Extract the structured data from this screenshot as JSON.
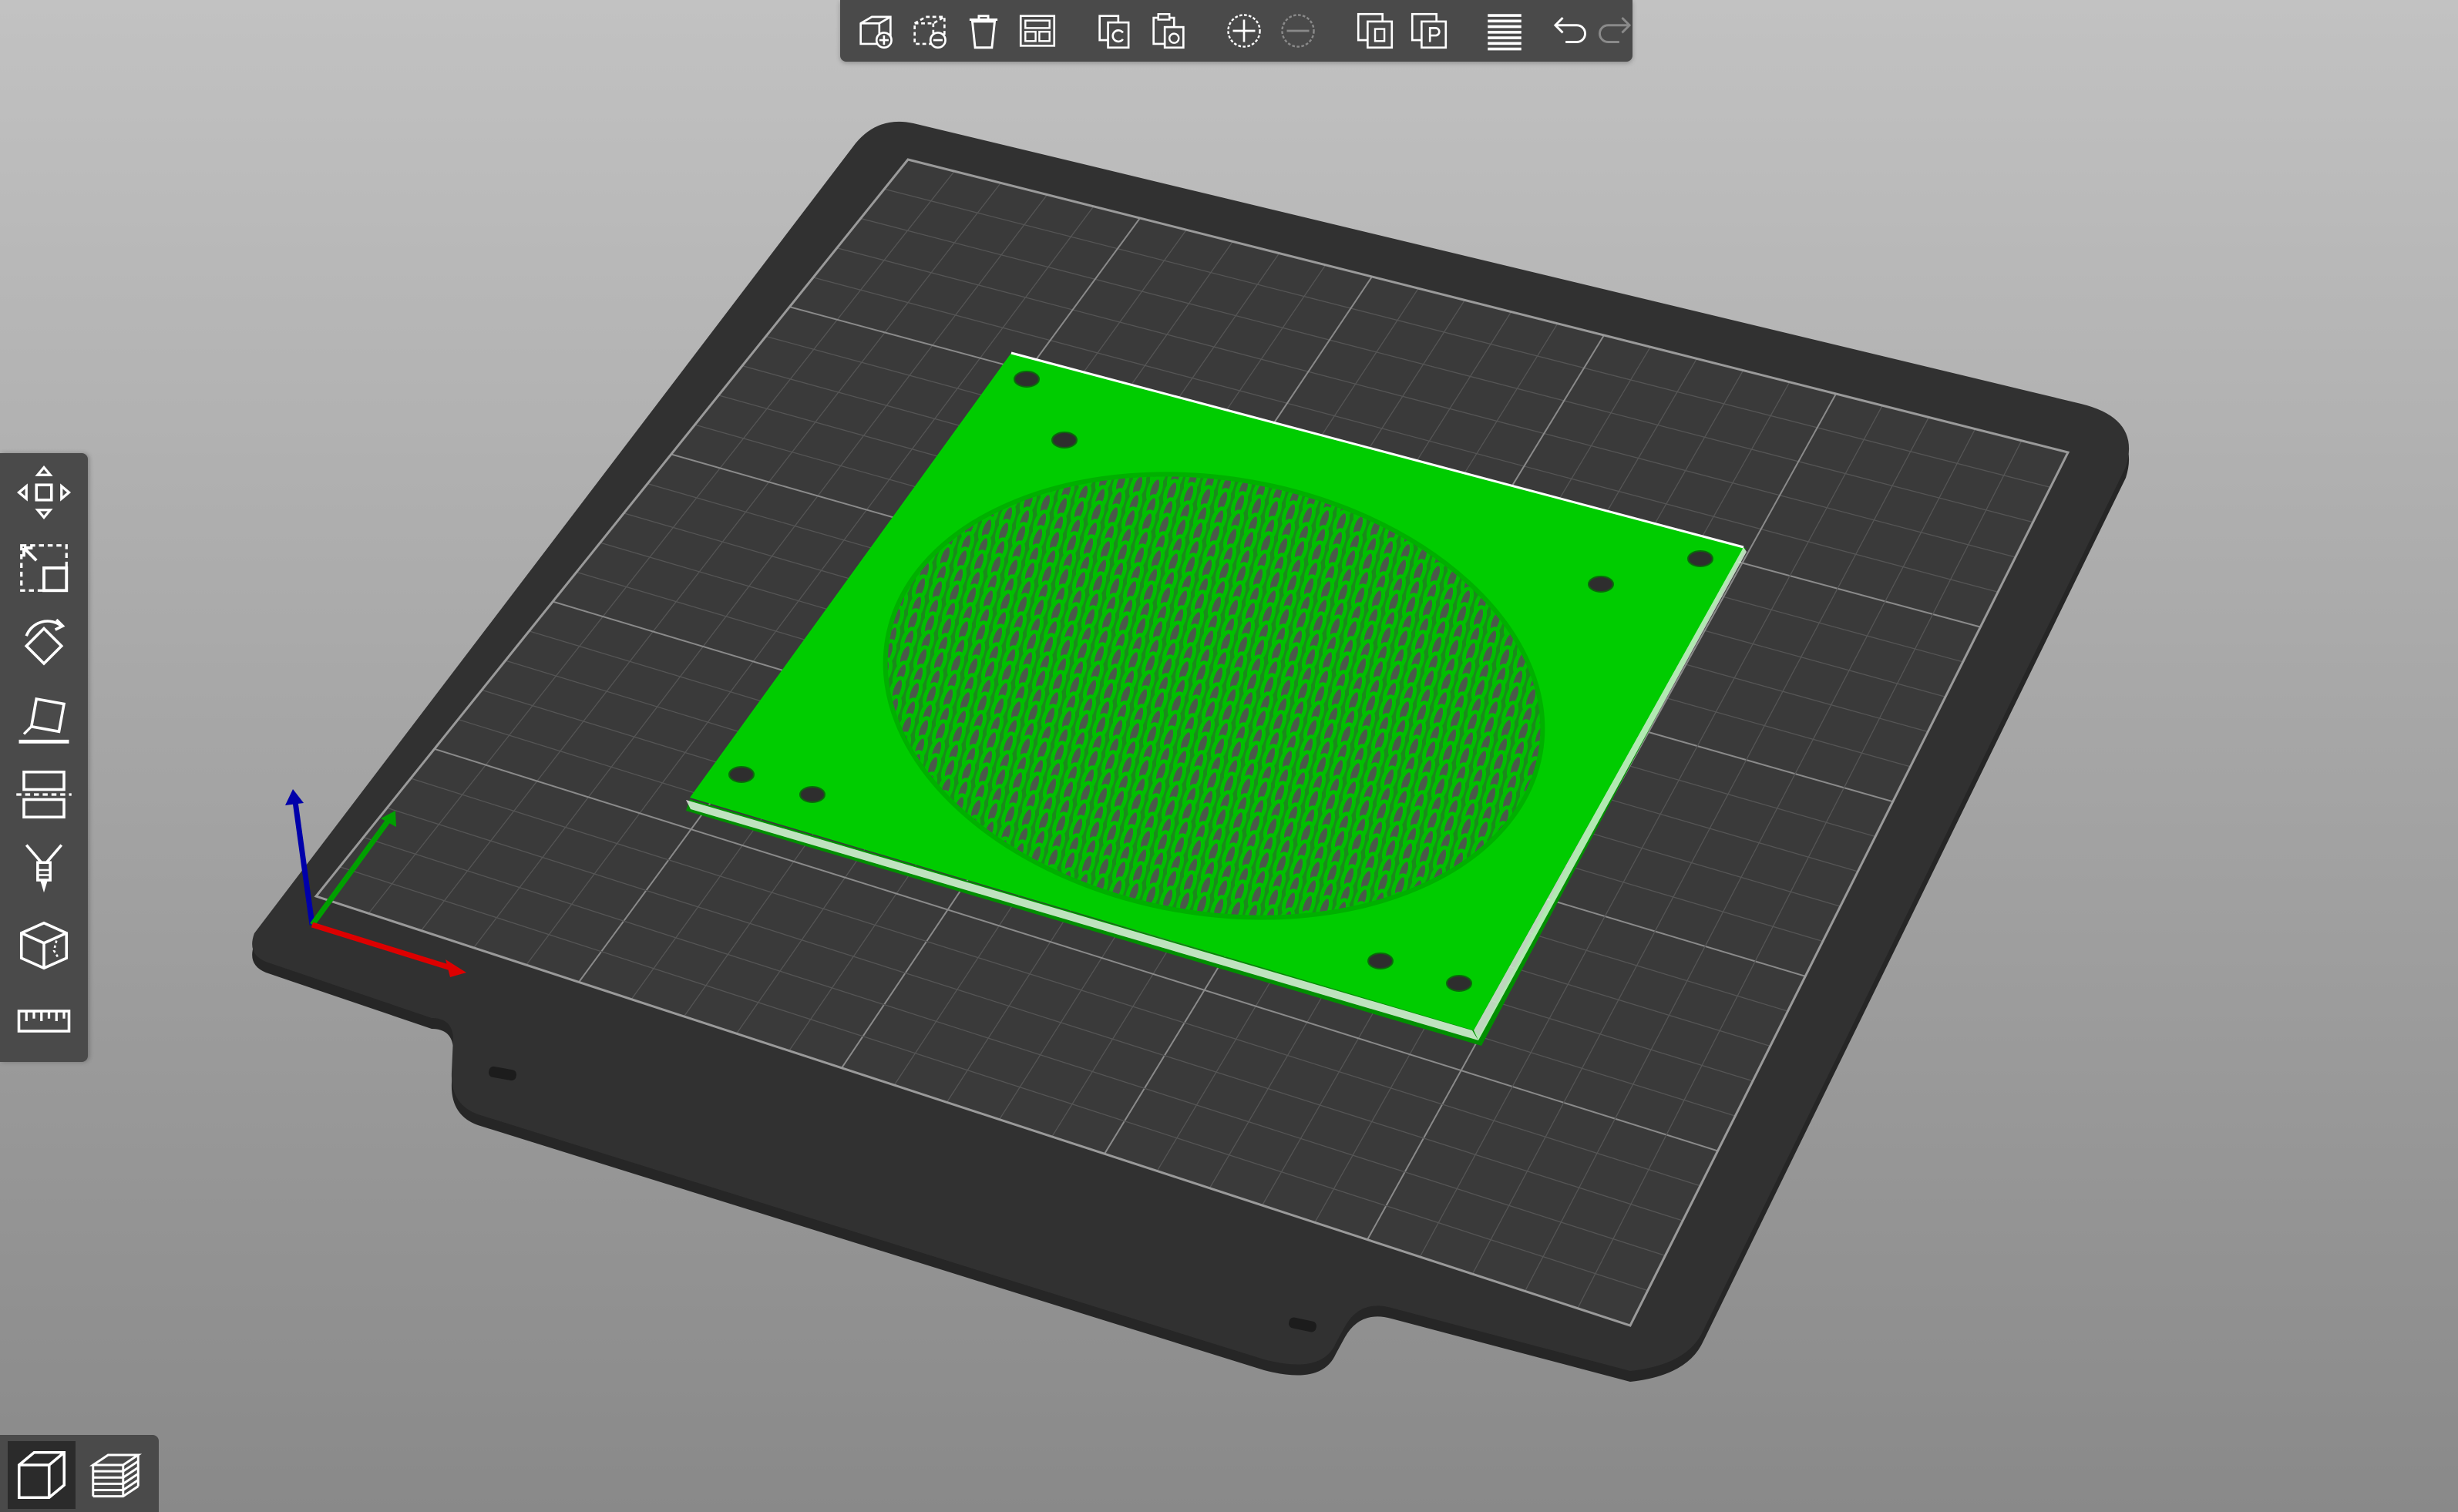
{
  "app": {
    "view": "3D editor",
    "background_top": "#c2c2c2",
    "background_bottom": "#898989"
  },
  "colors": {
    "bed": "#303030",
    "bed_edge": "#262626",
    "grid_minor": "#5a5a5a",
    "grid_major": "#8c8c8c",
    "model": "#00c800",
    "model_dark": "#009a00",
    "toolbar_bg": "#4a4a4a",
    "icon": "#ffffff",
    "icon_disabled": "#8a8a8a",
    "axis_x": "#dd0000",
    "axis_y": "#00a000",
    "axis_z": "#0000aa"
  },
  "top_toolbar": {
    "buttons": [
      {
        "name": "add-button",
        "icon": "add-icon",
        "enabled": true
      },
      {
        "name": "delete-button",
        "icon": "delete-icon",
        "enabled": true
      },
      {
        "name": "delete-all-button",
        "icon": "delete-all-icon",
        "enabled": true
      },
      {
        "name": "arrange-button",
        "icon": "arrange-icon",
        "enabled": true
      },
      {
        "name": "copy-button",
        "icon": "copy-icon",
        "enabled": true
      },
      {
        "name": "paste-button",
        "icon": "paste-icon",
        "enabled": true
      },
      {
        "name": "add-instance-button",
        "icon": "instance-add-icon",
        "enabled": true
      },
      {
        "name": "remove-instance-button",
        "icon": "instance-remove-icon",
        "enabled": false
      },
      {
        "name": "split-to-objects-button",
        "icon": "split-objects-icon",
        "enabled": true
      },
      {
        "name": "split-to-parts-button",
        "icon": "split-parts-icon",
        "enabled": true
      },
      {
        "name": "variable-layer-height-button",
        "icon": "layers-editing-icon",
        "enabled": true
      },
      {
        "name": "undo-button",
        "icon": "undo-icon",
        "enabled": true
      },
      {
        "name": "redo-button",
        "icon": "redo-icon",
        "enabled": false
      }
    ]
  },
  "left_toolbar": {
    "tools": [
      {
        "name": "move-tool",
        "icon": "move-icon"
      },
      {
        "name": "scale-tool",
        "icon": "scale-icon"
      },
      {
        "name": "rotate-tool",
        "icon": "rotate-icon"
      },
      {
        "name": "place-on-face-tool",
        "icon": "place-on-face-icon"
      },
      {
        "name": "cut-tool",
        "icon": "cut-icon"
      },
      {
        "name": "supports-painting-tool",
        "icon": "support-paint-icon"
      },
      {
        "name": "seam-painting-tool",
        "icon": "seam-paint-icon"
      },
      {
        "name": "measure-tool",
        "icon": "measure-icon"
      }
    ]
  },
  "view_switch": {
    "items": [
      {
        "name": "3d-view-tab",
        "icon": "cube-view-icon",
        "active": true
      },
      {
        "name": "preview-tab",
        "icon": "layers-preview-icon",
        "active": false
      }
    ]
  }
}
